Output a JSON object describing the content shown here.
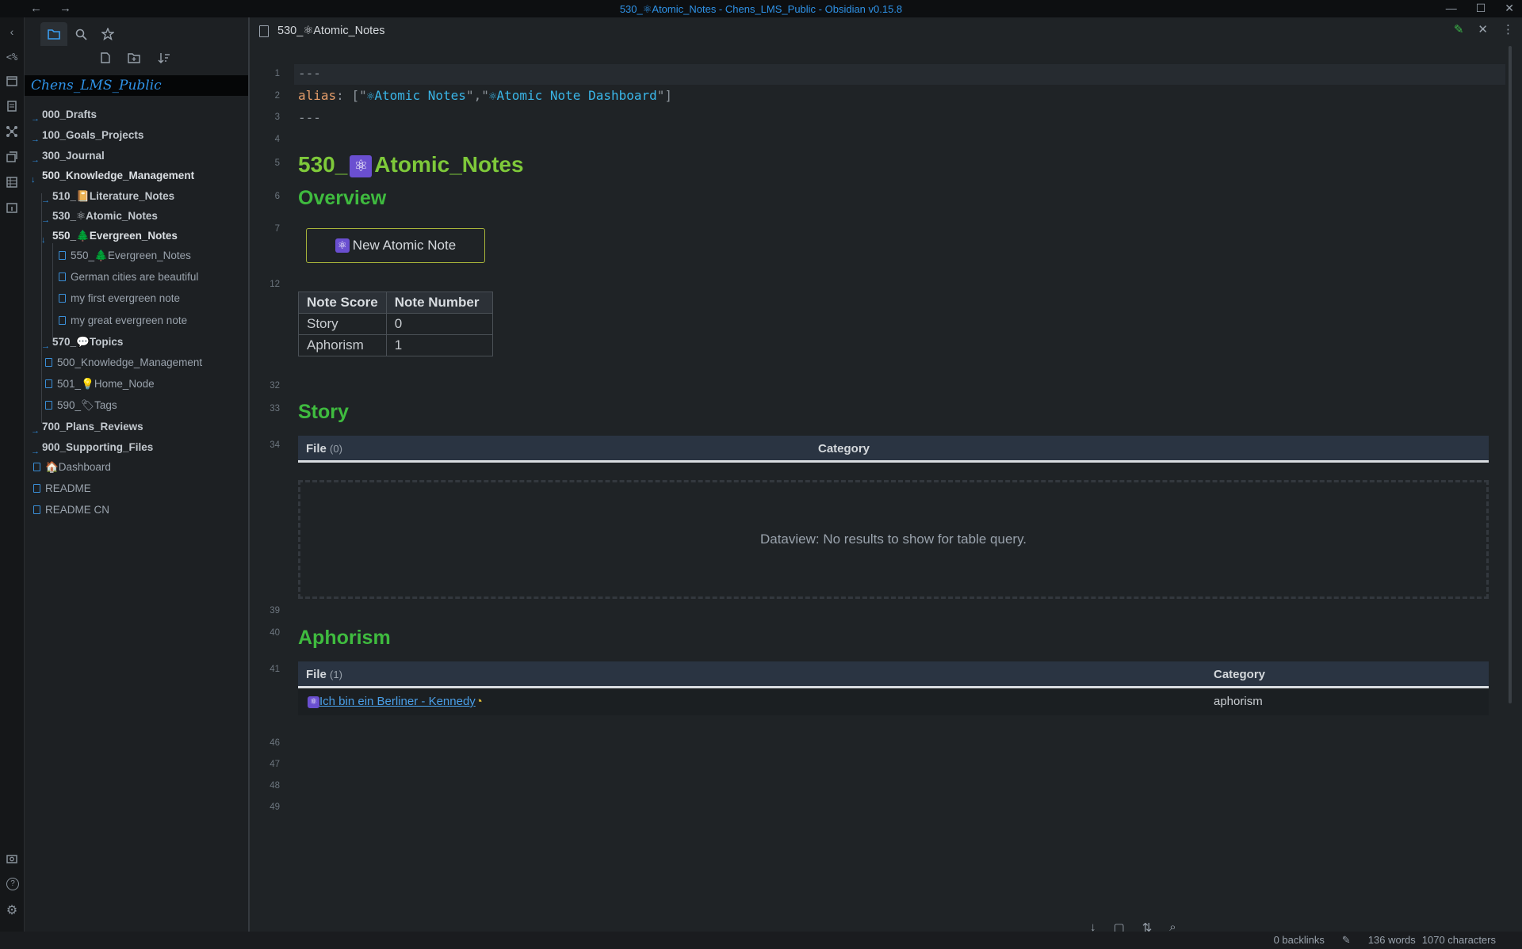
{
  "window": {
    "title": "530_⚛Atomic_Notes - Chens_LMS_Public - Obsidian v0.15.8",
    "back": "←",
    "forward": "→",
    "minimize": "—",
    "maximize": "☐",
    "close": "✕"
  },
  "ribbon": {
    "icons": [
      "command-palette-icon",
      "calendar-icon",
      "template-icon",
      "graph-icon",
      "card-icon",
      "database-icon",
      "daily-note-icon",
      "camera-icon",
      "help-icon",
      "settings-icon"
    ],
    "collapse": "‹",
    "glyphs": {
      "command": "<%",
      "help": "?",
      "settings": "⚙"
    }
  },
  "sidebar": {
    "tabs": [
      {
        "name": "file-explorer-tab-icon",
        "glyph": "🗀"
      },
      {
        "name": "search-tab-icon",
        "glyph": "⌕"
      },
      {
        "name": "bookmarks-tab-icon",
        "glyph": "☆"
      }
    ],
    "toolbar": {
      "new_note": "🗋",
      "new_folder": "🗀",
      "sort": "⇅"
    },
    "vault_name": "Chens_LMS_Public",
    "items": [
      {
        "label": "000_Drafts"
      },
      {
        "label": "100_Goals_Projects"
      },
      {
        "label": "300_Journal"
      },
      {
        "label": "500_Knowledge_Management"
      },
      {
        "label": "510_📔Literature_Notes"
      },
      {
        "label": "530_⚛Atomic_Notes"
      },
      {
        "label": "550_🌲Evergreen_Notes"
      },
      {
        "label": "550_🌲Evergreen_Notes"
      },
      {
        "label": "German cities are beautiful"
      },
      {
        "label": "my first evergreen note"
      },
      {
        "label": "my great evergreen note"
      },
      {
        "label": "570_💬Topics"
      },
      {
        "label": "500_Knowledge_Management"
      },
      {
        "label": "501_💡Home_Node"
      },
      {
        "label": "590_🏷Tags"
      },
      {
        "label": "700_Plans_Reviews"
      },
      {
        "label": "900_Supporting_Files"
      },
      {
        "label": "🏠Dashboard"
      },
      {
        "label": "README"
      },
      {
        "label": "README CN"
      }
    ]
  },
  "tab": {
    "title": "530_⚛Atomic_Notes",
    "edit_icon": "✎",
    "close_icon": "✕",
    "more_icon": "⋮"
  },
  "editor": {
    "line_numbers": [
      "1",
      "2",
      "3",
      "4",
      "5",
      "6",
      "7",
      "12",
      "32",
      "33",
      "34",
      "39",
      "40",
      "41",
      "46",
      "47",
      "48",
      "49"
    ],
    "frontmatter": {
      "dashes": "---",
      "alias_key": "alias",
      "colon": ": [\"",
      "alias_1": "⚛Atomic Notes",
      "sep": "\",\"",
      "alias_2": "⚛Atomic Note Dashboard",
      "end": "\"]"
    },
    "heading": {
      "prefix": "530_",
      "emoji": "⚛",
      "text": "Atomic_Notes"
    },
    "overview": "Overview",
    "button": {
      "emoji": "⚛",
      "label": "New Atomic Note"
    },
    "score_table": {
      "headers": [
        "Note Score",
        "Note Number"
      ],
      "rows": [
        [
          "Story",
          "0"
        ],
        [
          "Aphorism",
          "1"
        ]
      ]
    },
    "story": {
      "heading": "Story",
      "col_file": "File",
      "count": "(0)",
      "col_category": "Category",
      "empty": "Dataview: No results to show for table query."
    },
    "aphorism": {
      "heading": "Aphorism",
      "col_file": "File",
      "count": "(1)",
      "col_category": "Category",
      "row": {
        "emoji": "⚛",
        "link": "Ich bin ein Berliner - Kennedy",
        "suffix": "◔",
        "category": "aphorism"
      }
    }
  },
  "bottom_toolbar": {
    "down": "↓",
    "square": "▢",
    "sort": "⇅",
    "search": "⌕"
  },
  "status": {
    "backlinks": "0 backlinks",
    "pencil": "✎",
    "words": "136 words",
    "chars": "1070 characters"
  },
  "colors": {
    "accent": "#2f93e8",
    "heading_h1": "#7ec93a",
    "heading_h2": "#3fbb3f",
    "yaml_key": "#e59d6a",
    "yaml_string": "#3ab6e8",
    "atom_emoji_bg": "#6a4fd0"
  }
}
